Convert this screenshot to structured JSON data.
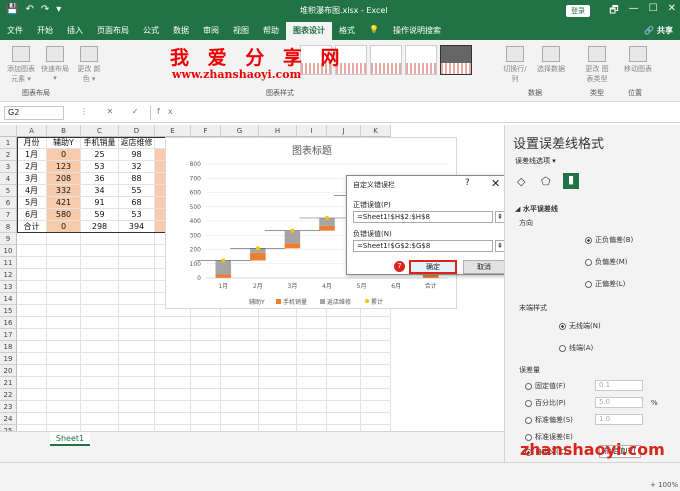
{
  "titlebar": {
    "doc_title": "堆积瀑布图.xlsx  -  Excel",
    "login": "登录",
    "qat": [
      "💾",
      "↶",
      "↷",
      "▾"
    ],
    "win": [
      "🗗",
      "—",
      "☐",
      "✕"
    ]
  },
  "tabs": [
    "文件",
    "开始",
    "插入",
    "页面布局",
    "公式",
    "数据",
    "审阅",
    "视图",
    "帮助",
    "图表设计",
    "格式",
    "💡",
    "操作说明搜索"
  ],
  "share": "🔗 共享",
  "ribbon": {
    "add_element": "添加图表\n元素 ▾",
    "quick_layout": "快速布局\n▾",
    "change_colors": "更改\n颜色 ▾",
    "switch_rowcol": "切换行/列",
    "select_data": "选择数据",
    "change_type": "更改\n图表类型",
    "move_chart": "移动图表",
    "groups": [
      "图表布局",
      "图表样式",
      "数据",
      "类型",
      "位置"
    ]
  },
  "watermark": {
    "title": "我 爱 分 享 网",
    "url": "www.zhanshaoyi.com",
    "corner": "zhanshaoyi.com"
  },
  "formula_bar": {
    "namebox": "G2",
    "icons": "⋮ ✕ ✓ fx",
    "formula": ""
  },
  "columns": [
    "A",
    "B",
    "C",
    "D",
    "E",
    "F",
    "G",
    "H",
    "I",
    "J",
    "K"
  ],
  "rows": [
    [
      "月份",
      "辅助Y",
      "手机销量",
      "返店维修",
      "累计",
      "",
      "左横线长",
      "右横线长",
      "",
      "",
      ""
    ],
    [
      "1月",
      "0",
      "25",
      "98",
      "123",
      "",
      "",
      "1.2",
      "",
      "",
      ""
    ],
    [
      "2月",
      "123",
      "53",
      "32",
      "208",
      "",
      "0.2",
      "1.2",
      "",
      "",
      ""
    ],
    [
      "3月",
      "208",
      "36",
      "88",
      "332",
      "",
      "0.2",
      "1.2",
      "",
      "",
      ""
    ],
    [
      "4月",
      "332",
      "34",
      "55",
      "421",
      "",
      "0.2",
      "1.2",
      "",
      "",
      ""
    ],
    [
      "5月",
      "421",
      "91",
      "68",
      "580",
      "",
      "0.2",
      "1.2",
      "",
      "",
      ""
    ],
    [
      "6月",
      "580",
      "59",
      "53",
      "692",
      "",
      "0.2",
      "1.2",
      "",
      "",
      ""
    ],
    [
      "合计",
      "0",
      "298",
      "394",
      "692",
      "",
      "",
      "",
      "",
      "",
      ""
    ]
  ],
  "chart_data": {
    "type": "bar",
    "title": "图表标题",
    "categories": [
      "1月",
      "2月",
      "3月",
      "4月",
      "5月",
      "6月",
      "合计"
    ],
    "series": [
      {
        "name": "辅助Y",
        "values": [
          0,
          123,
          208,
          332,
          421,
          580,
          0
        ],
        "color": "none"
      },
      {
        "name": "手机销量",
        "values": [
          25,
          53,
          36,
          34,
          91,
          59,
          298
        ],
        "color": "#ed7d31"
      },
      {
        "name": "返店维修",
        "values": [
          98,
          32,
          88,
          55,
          68,
          53,
          394
        ],
        "color": "#a5a5a5"
      },
      {
        "name": "累计",
        "values": [
          123,
          208,
          332,
          421,
          580,
          692,
          692
        ],
        "color": "#ffc000",
        "marker": true
      }
    ],
    "yticks": [
      "0",
      "100",
      "200",
      "300",
      "400",
      "500",
      "600",
      "700",
      "800"
    ],
    "ylim": [
      0,
      800
    ],
    "legend": "bottom"
  },
  "dialog": {
    "title": "自定义错误栏",
    "help": "?",
    "close": "✕",
    "pos_label": "正错误值(P)",
    "pos_value": "=Sheet1!$H$2:$H$8",
    "neg_label": "负错误值(N)",
    "neg_value": "=Sheet1!$G$2:$G$8",
    "step": "7",
    "ok": "确定",
    "cancel": "取消",
    "ref_icon": "⇞"
  },
  "pane": {
    "title": "设置误差线格式",
    "subtitle": "误差线选项 ▾",
    "section": "◢ 水平误差线",
    "direction": "方向",
    "dir_options": [
      "正负偏差(B)",
      "负偏差(M)",
      "正偏差(L)"
    ],
    "endstyle": "末端样式",
    "end_options": [
      "无线端(N)",
      "线端(A)"
    ],
    "amount": "误差量",
    "amount_options": [
      "固定值(F)",
      "百分比(P)",
      "标准偏差(S)",
      "标准误差(E)",
      "自定义(C)"
    ],
    "amount_values": [
      "0.1",
      "5.0",
      "1.0"
    ],
    "pct": "%",
    "specify": "指定值(V)",
    "icons": [
      "◇",
      "⬠",
      "▮"
    ]
  },
  "sheet_tab": "Sheet1",
  "zoom": "+ 100%"
}
